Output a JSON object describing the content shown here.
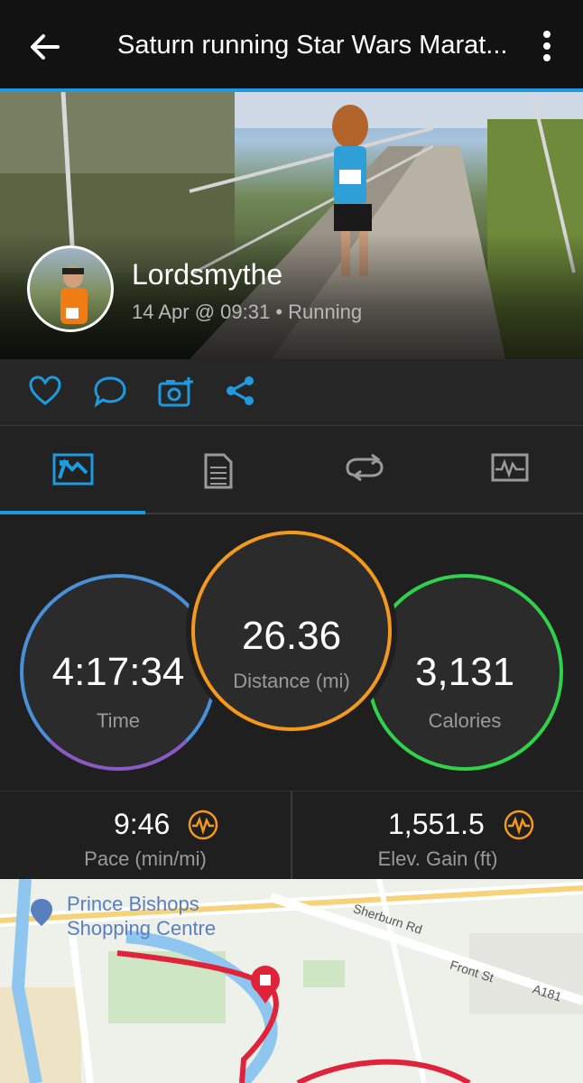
{
  "header": {
    "title": "Saturn running Star Wars Marat...",
    "back_icon": "arrow-left-icon",
    "menu_icon": "more-vertical-icon"
  },
  "activity": {
    "username": "Lordsmythe",
    "meta": "14 Apr @ 09:31 • Running"
  },
  "actions": [
    "heart-icon",
    "comment-icon",
    "add-photo-icon",
    "share-icon"
  ],
  "tabs": [
    "overview-tab",
    "details-tab",
    "laps-tab",
    "charts-tab"
  ],
  "stats": {
    "time": {
      "value": "4:17:34",
      "label": "Time"
    },
    "distance": {
      "value": "26.36",
      "label": "Distance (mi)"
    },
    "calories": {
      "value": "3,131",
      "label": "Calories"
    }
  },
  "metrics": {
    "pace": {
      "value": "9:46",
      "label": "Pace (min/mi)"
    },
    "elevation": {
      "value": "1,551.5",
      "label": "Elev. Gain (ft)"
    }
  },
  "map": {
    "poi": "Prince Bishops Shopping Centre",
    "poi_line1": "Prince Bishops",
    "poi_line2": "Shopping Centre",
    "road1": "Sherburn Rd",
    "road2": "Front St",
    "road3": "A181"
  },
  "colors": {
    "accent": "#1e9be0",
    "time_ring": "#4a90d9",
    "distance_ring": "#f39a1e",
    "calories_ring": "#2fd24a",
    "route": "#e0223a"
  }
}
